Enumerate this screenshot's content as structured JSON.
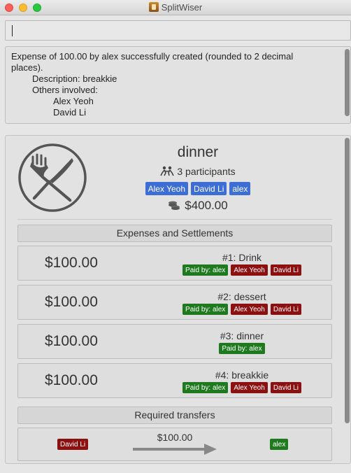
{
  "window": {
    "title": "SplitWiser"
  },
  "command": {
    "value": ""
  },
  "result": {
    "lines": [
      "Expense of 100.00 by alex successfully created (rounded to 2 decimal",
      "places).",
      "Description: breakkie",
      "Others involved:",
      "Alex Yeoh",
      "David Li"
    ]
  },
  "activity": {
    "title": "dinner",
    "participants_text": "3 participants",
    "participants": [
      "Alex Yeoh",
      "David Li",
      "alex"
    ],
    "total": "$400.00",
    "expenses_header": "Expenses and Settlements",
    "expenses": [
      {
        "amount": "$100.00",
        "title": "#1: Drink",
        "paid_by": "Paid by: alex",
        "others": [
          "Alex Yeoh",
          "David Li"
        ]
      },
      {
        "amount": "$100.00",
        "title": "#2: dessert",
        "paid_by": "Paid by: alex",
        "others": [
          "Alex Yeoh",
          "David Li"
        ]
      },
      {
        "amount": "$100.00",
        "title": "#3: dinner",
        "paid_by": "Paid by: alex",
        "others": []
      },
      {
        "amount": "$100.00",
        "title": "#4: breakkie",
        "paid_by": "Paid by: alex",
        "others": [
          "Alex Yeoh",
          "David Li"
        ]
      }
    ],
    "transfers_header": "Required transfers",
    "transfers": [
      {
        "from": "David Li",
        "amount": "$100.00",
        "to": "alex"
      }
    ]
  },
  "icons": {
    "app": "app-icon",
    "main": "fork-knife-icon",
    "participants": "people-icon",
    "total": "coins-icon",
    "transfer": "arrow-right-icon"
  },
  "colors": {
    "participant_tag": "#3c6ed6",
    "paid_by_tag": "#1f7a1f",
    "other_tag": "#8c1010"
  }
}
